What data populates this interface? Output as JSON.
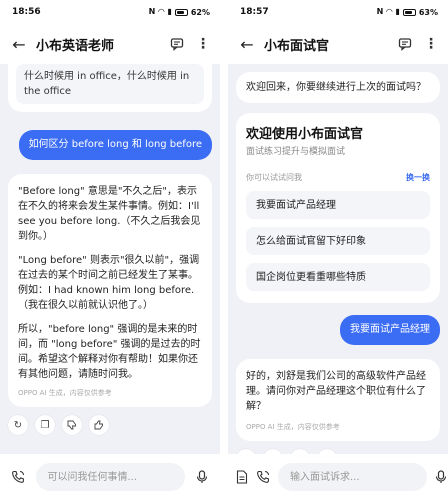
{
  "left": {
    "status": {
      "time": "18:56",
      "indicator": "N",
      "battery": "62%"
    },
    "header": {
      "title": "小布英语老师"
    },
    "suggestion": "什么时候用 in office，什么时候用 in the office",
    "user_message": "如何区分 before long 和 long before",
    "ai_reply": {
      "p1": "\"Before long\" 意思是\"不久之后\"，表示在不久的将来会发生某件事情。例如：I'll see you before long.（不久之后我会见到你。）",
      "p2": "\"Long before\" 则表示\"很久以前\"，强调在过去的某个时间之前已经发生了某事。例如：I had known him long before.（我在很久以前就认识他了。）",
      "p3": "所以，\"before long\" 强调的是未来的时间，而 \"long before\" 强调的是过去的时间。希望这个解释对你有帮助！如果你还有其他问题，请随时问我。",
      "disclaimer": "OPPO AI 生成，内容仅供参考"
    },
    "input": {
      "placeholder": "可以问我任何事情..."
    }
  },
  "right": {
    "status": {
      "time": "18:57",
      "indicator": "N",
      "battery": "63%"
    },
    "header": {
      "title": "小布面试官"
    },
    "greeting": "欢迎回来，你要继续进行上次的面试吗？",
    "welcome": {
      "title": "欢迎使用小布面试官",
      "subtitle": "面试练习提升与模拟面试",
      "ask_label": "你可以试试问我",
      "refresh_label": "换一换",
      "options": [
        "我要面试产品经理",
        "怎么给面试官留下好印象",
        "国企岗位更看重哪些特质"
      ]
    },
    "user_message": "我要面试产品经理",
    "ai_reply": {
      "text": "好的，刘舒是我们公司的高级软件产品经理。请问你对产品经理这个职位有什么了解？",
      "disclaimer": "OPPO AI 生成，内容仅供参考"
    },
    "input": {
      "placeholder": "输入面试诉求..."
    }
  },
  "colors": {
    "accent": "#3b6cf4",
    "chat_bg": "#f0f1f6"
  },
  "icons": [
    "back-arrow-icon",
    "chat-history-icon",
    "more-vert-icon",
    "copy-icon",
    "regenerate-icon",
    "thumb-up-icon",
    "thumb-down-icon",
    "phone-call-icon",
    "mic-icon",
    "document-icon"
  ]
}
